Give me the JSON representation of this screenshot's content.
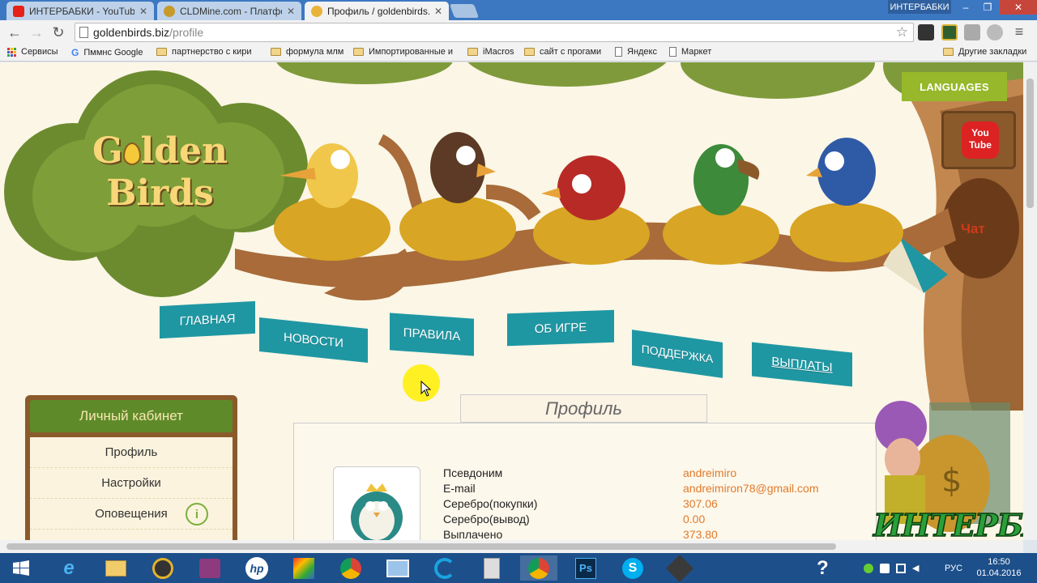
{
  "browser": {
    "tabs": [
      {
        "title": "ИНТЕРБАБКИ - YouTube",
        "favicon_color": "#e62117",
        "active": false
      },
      {
        "title": "CLDMine.com - Платфор",
        "favicon_color": "#c89a2a",
        "active": false
      },
      {
        "title": "Профиль / goldenbirds.b",
        "favicon_color": "#e8b33a",
        "active": true
      }
    ],
    "user_badge": "ИНТЕРБАБКИ",
    "url_host": "goldenbirds.biz",
    "url_path": "/profile",
    "bookmarks": [
      {
        "label": "Сервисы",
        "type": "apps"
      },
      {
        "label": "Пммнс Google",
        "type": "google"
      },
      {
        "label": "партнерство с кири",
        "type": "folder"
      },
      {
        "label": "формула млм",
        "type": "folder"
      },
      {
        "label": "Импортированные и",
        "type": "folder"
      },
      {
        "label": "iMacros",
        "type": "folder"
      },
      {
        "label": "сайт с прогами",
        "type": "folder"
      },
      {
        "label": "Яндекс",
        "type": "doc"
      },
      {
        "label": "Маркет",
        "type": "doc"
      }
    ],
    "other_bookmarks": "Другие закладки"
  },
  "site": {
    "logo": {
      "line1": "G",
      "line1_rest": "lden",
      "line2": "Birds"
    },
    "languages_button": "LANGUAGES",
    "youtube_label_top": "You",
    "youtube_label_bottom": "Tube",
    "chat_link": "Чат",
    "nav": [
      "ГЛАВНАЯ",
      "НОВОСТИ",
      "ПРАВИЛА",
      "ОБ ИГРЕ",
      "ПОДДЕРЖКА",
      "ВЫПЛАТЫ"
    ],
    "sidebar": {
      "title": "Личный кабинет",
      "items": [
        "Профиль",
        "Настройки",
        "Оповещения"
      ],
      "notification_icon": "i"
    },
    "profile": {
      "title": "Профиль",
      "fields": [
        {
          "label": "Псевдоним",
          "value": "andreimiro"
        },
        {
          "label": "E-mail",
          "value": "andreimiron78@gmail.com"
        },
        {
          "label": "Серебро(покупки)",
          "value": "307.06"
        },
        {
          "label": "Серебро(вывод)",
          "value": "0.00"
        },
        {
          "label": "Выплачено",
          "value": "373.80"
        }
      ]
    }
  },
  "watermark": "ИНТЕРБАБКИ",
  "taskbar": {
    "language": "РУС",
    "time": "16:50",
    "date": "01.04.2016"
  },
  "colors": {
    "nav_flag": "#1f97a3",
    "languages_bg": "#96b82a",
    "value_text": "#e07b2c",
    "sidebar_head": "#5f8a2a"
  }
}
